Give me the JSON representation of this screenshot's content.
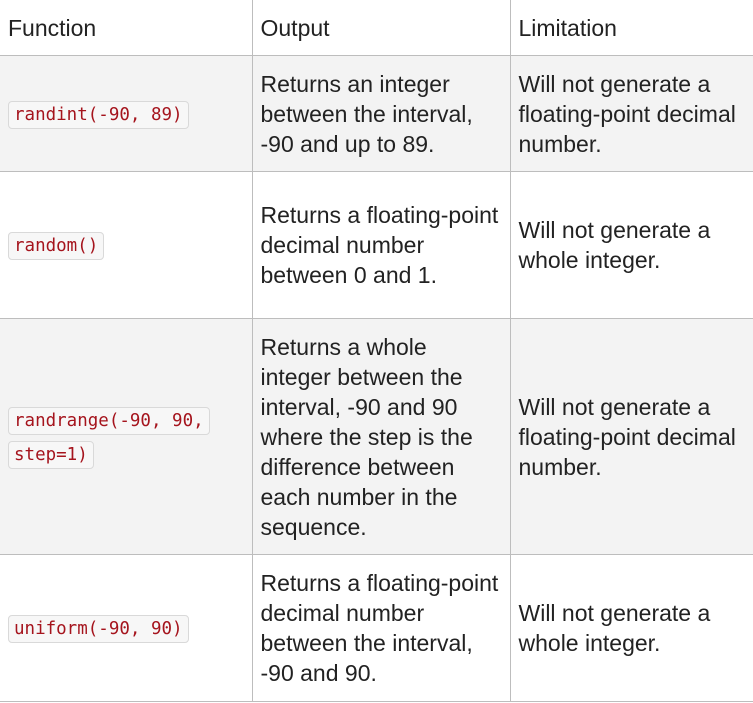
{
  "headers": [
    "Function",
    "Output",
    "Limitation"
  ],
  "rows": [
    {
      "function": "randint(-90, 89)",
      "output": "Returns an integer between the interval, -90 and up to 89.",
      "limitation": "Will not generate a floating-point decimal number."
    },
    {
      "function": "random()",
      "output": "Returns a floating-point decimal number between 0 and 1.",
      "limitation": "Will not generate a whole integer."
    },
    {
      "function": "randrange(-90, 90, step=1)",
      "output": "Returns a whole integer between the interval, -90 and 90 where the step is the difference between each number in the sequence.",
      "limitation": "Will not generate a floating-point decimal number."
    },
    {
      "function": "uniform(-90, 90)",
      "output": "Returns a floating-point decimal number between the interval, -90 and 90.",
      "limitation": "Will not generate a whole integer."
    }
  ]
}
